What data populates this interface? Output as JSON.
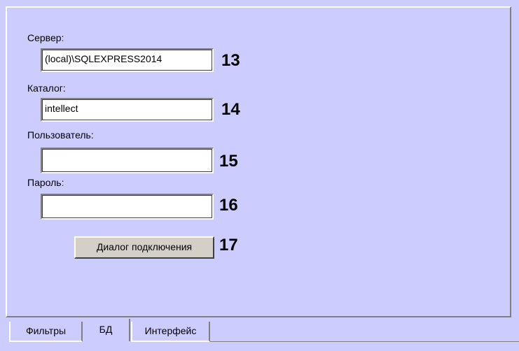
{
  "form": {
    "server_label": "Сервер:",
    "server_value": "(local)\\SQLEXPRESS2014",
    "server_num": "13",
    "catalog_label": "Каталог:",
    "catalog_value": "intellect",
    "catalog_num": "14",
    "user_label": "Пользователь:",
    "user_value": "",
    "user_num": "15",
    "password_label": "Пароль:",
    "password_value": "",
    "password_num": "16",
    "connect_button": "Диалог подключения",
    "connect_num": "17"
  },
  "tabs": [
    {
      "label": "Фильтры",
      "active": false
    },
    {
      "label": "БД",
      "active": true
    },
    {
      "label": "Интерфейс",
      "active": false
    }
  ],
  "colors": {
    "panel_bg": "#ccccff",
    "button_bg": "#d4d0c8"
  }
}
